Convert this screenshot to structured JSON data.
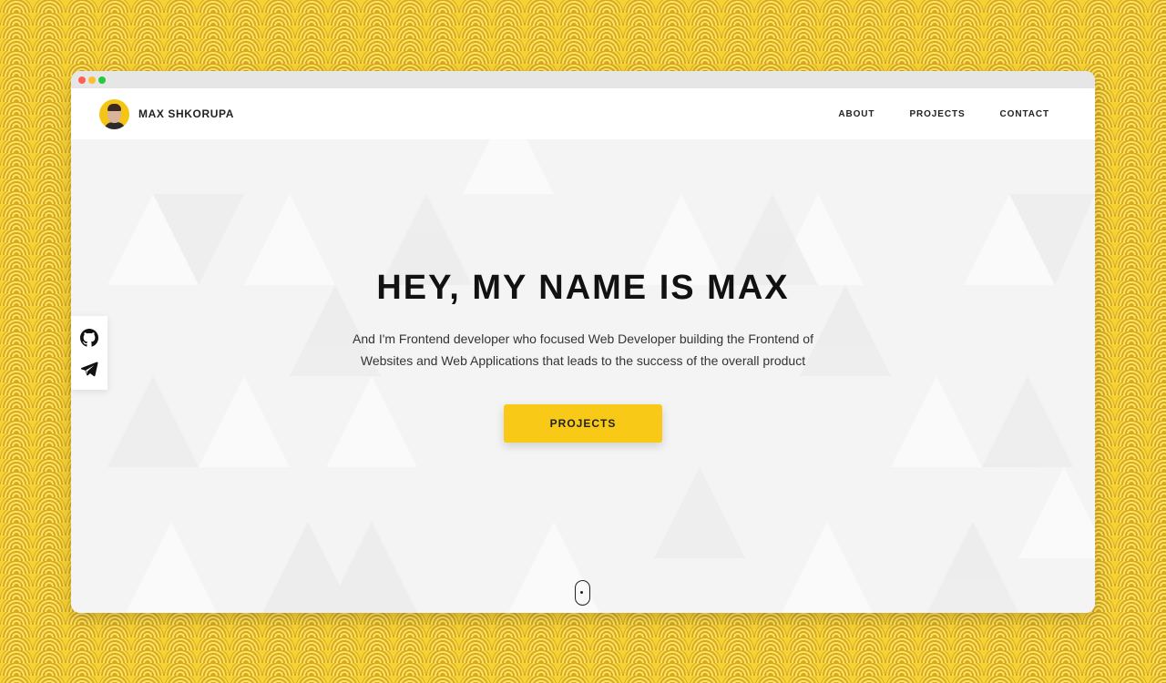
{
  "window": {
    "controls": [
      "close",
      "minimize",
      "maximize"
    ]
  },
  "header": {
    "brand": {
      "name": "MAX SHKORUPA",
      "avatar_icon": "avatar-photo"
    },
    "nav": [
      {
        "label": "ABOUT"
      },
      {
        "label": "PROJECTS"
      },
      {
        "label": "CONTACT"
      }
    ]
  },
  "hero": {
    "title": "HEY, MY NAME IS MAX",
    "text": "And I'm Frontend developer who focused Web Developer building the Frontend of Websites and Web Applications that leads to the success of the overall product",
    "cta_label": "PROJECTS",
    "scroll_indicator_icon": "mouse-scroll-icon"
  },
  "social": [
    {
      "icon": "github-icon"
    },
    {
      "icon": "telegram-icon"
    }
  ],
  "colors": {
    "accent": "#f8c916",
    "background_pattern": "#f6d335",
    "hero_bg": "#f4f4f4",
    "text_dark": "#111111"
  }
}
